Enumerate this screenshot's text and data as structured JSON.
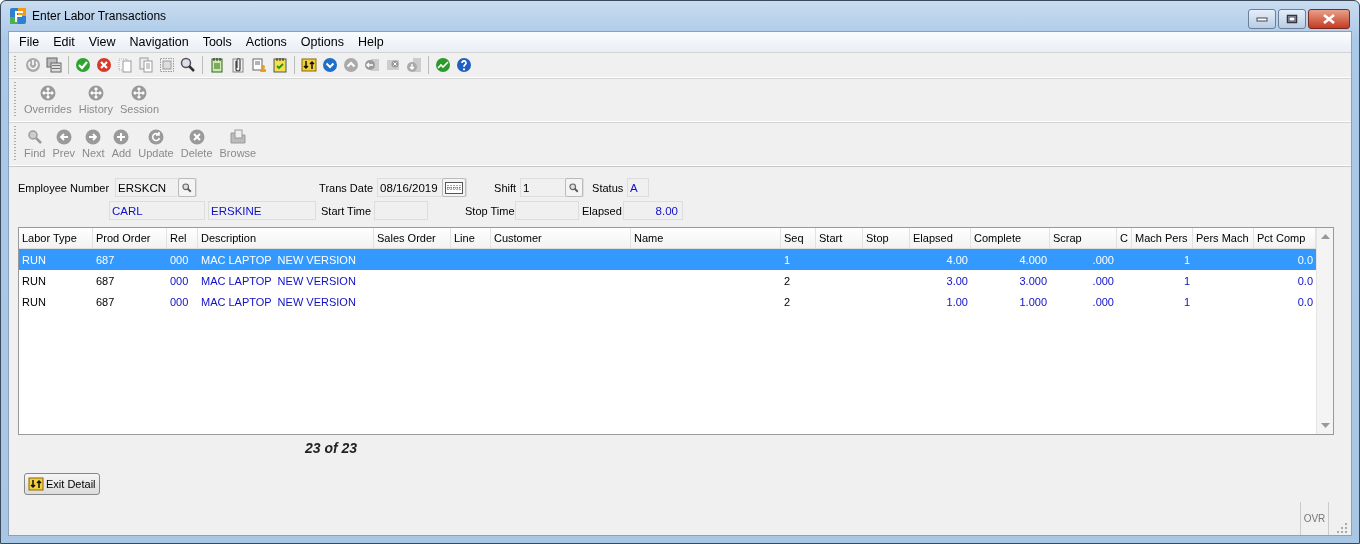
{
  "window": {
    "title": "Enter Labor Transactions"
  },
  "menu": [
    "File",
    "Edit",
    "View",
    "Navigation",
    "Tools",
    "Actions",
    "Options",
    "Help"
  ],
  "section_toolbar": [
    {
      "label": "Overrides",
      "disabled": true
    },
    {
      "label": "History",
      "disabled": true
    },
    {
      "label": "Session",
      "disabled": true
    }
  ],
  "record_toolbar": [
    {
      "label": "Find",
      "disabled": true
    },
    {
      "label": "Prev",
      "disabled": true
    },
    {
      "label": "Next",
      "disabled": true
    },
    {
      "label": "Add",
      "disabled": true
    },
    {
      "label": "Update",
      "disabled": true
    },
    {
      "label": "Delete",
      "disabled": true
    },
    {
      "label": "Browse",
      "disabled": true
    }
  ],
  "form": {
    "employee_number": {
      "label": "Employee Number",
      "value": "ERSKCN"
    },
    "first_name": {
      "value": "CARL"
    },
    "last_name": {
      "value": "ERSKINE"
    },
    "trans_date": {
      "label": "Trans Date",
      "value": "08/16/2019"
    },
    "start_time": {
      "label": "Start Time"
    },
    "shift": {
      "label": "Shift",
      "value": "1"
    },
    "stop_time": {
      "label": "Stop Time"
    },
    "status": {
      "label": "Status",
      "value": "A"
    },
    "elapsed": {
      "label": "Elapsed",
      "value": "8.00"
    }
  },
  "table": {
    "columns": [
      {
        "label": "Labor Type",
        "kind": "key"
      },
      {
        "label": "Prod Order",
        "kind": "key"
      },
      {
        "label": "Rel",
        "kind": "text"
      },
      {
        "label": "Description",
        "kind": "text"
      },
      {
        "label": "Sales Order",
        "kind": "text"
      },
      {
        "label": "Line",
        "kind": "text"
      },
      {
        "label": "Customer",
        "kind": "text"
      },
      {
        "label": "Name",
        "kind": "text"
      },
      {
        "label": "Seq",
        "kind": "key"
      },
      {
        "label": "Start",
        "kind": "text"
      },
      {
        "label": "Stop",
        "kind": "text"
      },
      {
        "label": "Elapsed",
        "kind": "number"
      },
      {
        "label": "Complete",
        "kind": "number"
      },
      {
        "label": "Scrap",
        "kind": "number"
      },
      {
        "label": "C",
        "kind": "text"
      },
      {
        "label": "Mach Pers",
        "kind": "number"
      },
      {
        "label": "Pers Mach",
        "kind": "number"
      },
      {
        "label": "Pct Comp",
        "kind": "number"
      }
    ],
    "rows": [
      {
        "selected": true,
        "cells": [
          "RUN",
          "687",
          "000",
          "MAC LAPTOP  NEW VERSION",
          null,
          null,
          null,
          null,
          "1",
          null,
          null,
          "4.00",
          "4.000",
          ".000",
          null,
          "1",
          null,
          "0.0"
        ]
      },
      {
        "selected": false,
        "cells": [
          "RUN",
          "687",
          "000",
          "MAC LAPTOP  NEW VERSION",
          null,
          null,
          null,
          null,
          "2",
          null,
          null,
          "3.00",
          "3.000",
          ".000",
          null,
          "1",
          null,
          "0.0"
        ]
      },
      {
        "selected": false,
        "cells": [
          "RUN",
          "687",
          "000",
          "MAC LAPTOP  NEW VERSION",
          null,
          null,
          null,
          null,
          "2",
          null,
          null,
          "1.00",
          "1.000",
          ".000",
          null,
          "1",
          null,
          "0.0"
        ]
      }
    ]
  },
  "record_count": "23 of 23",
  "buttons": [
    {
      "label": "Exit Detail"
    }
  ],
  "status_bar": {
    "mode": "OVR"
  }
}
